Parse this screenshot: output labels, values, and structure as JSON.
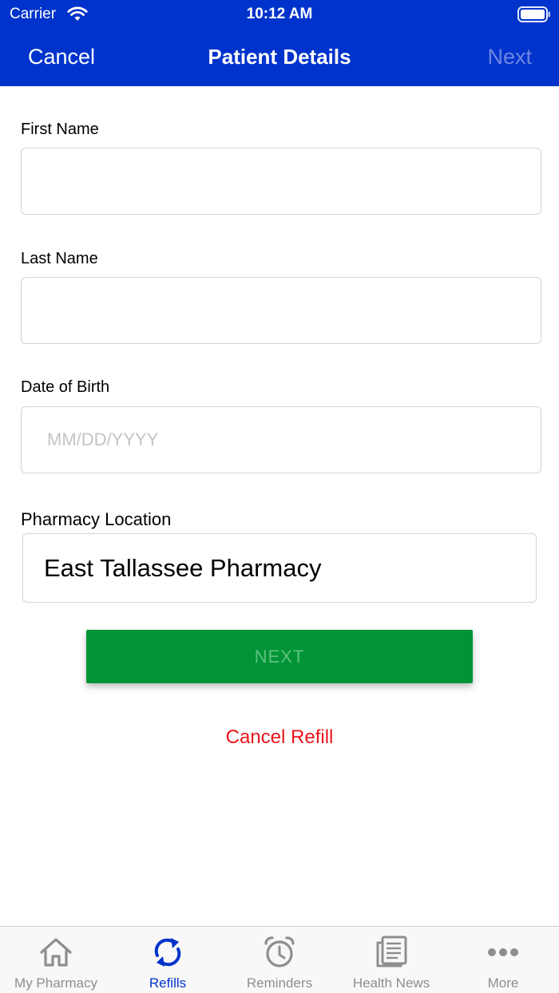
{
  "status_bar": {
    "carrier": "Carrier",
    "time": "10:12 AM",
    "wifi_icon": "wifi-icon",
    "battery_icon": "battery-icon"
  },
  "nav": {
    "cancel_label": "Cancel",
    "title": "Patient Details",
    "next_label": "Next",
    "bar_color": "#0033cc",
    "next_disabled_color": "#6d86e2"
  },
  "form": {
    "first_name": {
      "label": "First Name",
      "value": "",
      "placeholder": ""
    },
    "last_name": {
      "label": "Last Name",
      "value": "",
      "placeholder": ""
    },
    "dob": {
      "label": "Date of Birth",
      "value": "",
      "placeholder": "MM/DD/YYYY"
    },
    "pharmacy": {
      "label": "Pharmacy Location",
      "value": "East Tallassee Pharmacy"
    }
  },
  "actions": {
    "next_label": "NEXT",
    "next_color": "#009435",
    "cancel_refill_label": "Cancel Refill",
    "cancel_refill_color": "#e8141a"
  },
  "tabbar": {
    "active_color": "#0033cc",
    "inactive_color": "#8e8e8e",
    "items": [
      {
        "label": "My Pharmacy",
        "icon": "home-icon",
        "active": false
      },
      {
        "label": "Refills",
        "icon": "refresh-icon",
        "active": true
      },
      {
        "label": "Reminders",
        "icon": "alarm-clock-icon",
        "active": false
      },
      {
        "label": "Health News",
        "icon": "newspaper-icon",
        "active": false
      },
      {
        "label": "More",
        "icon": "more-dots-icon",
        "active": false
      }
    ]
  }
}
